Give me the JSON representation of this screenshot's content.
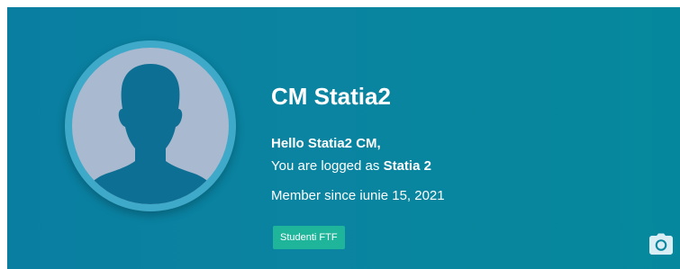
{
  "profile": {
    "display_name": "CM Statia2",
    "greeting": "Hello Statia2 CM,",
    "logged_prefix": "You are logged as ",
    "logged_user": "Statia 2",
    "member_since": "Member since iunie 15, 2021",
    "badge": "Studenti FTF"
  },
  "icons": {
    "avatar": "default-user-silhouette-icon",
    "camera": "camera-icon"
  },
  "colors": {
    "banner_start": "#0a7ea1",
    "banner_end": "#05889d",
    "avatar_ring": "#3fa9c9",
    "avatar_bg": "#a9b9cf",
    "silhouette": "#0e6f95",
    "badge_bg": "#1fb59b",
    "text": "#ffffff"
  }
}
